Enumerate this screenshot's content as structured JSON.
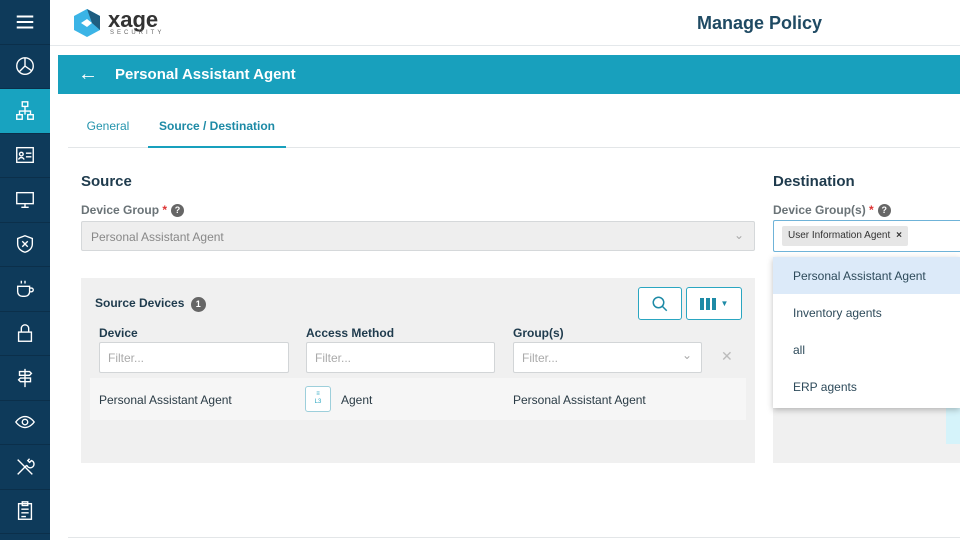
{
  "brand": {
    "name": "xage",
    "tagline": "SECURITY"
  },
  "page_title": "Manage Policy",
  "header": {
    "title": "Personal Assistant Agent"
  },
  "tabs": [
    {
      "label": "General"
    },
    {
      "label": "Source / Destination"
    }
  ],
  "source": {
    "heading": "Source",
    "device_group_label": "Device Group",
    "device_group_value": "Personal Assistant Agent",
    "devices": {
      "title": "Source Devices",
      "count": "1",
      "columns": [
        "Device",
        "Access Method",
        "Group(s)"
      ],
      "filter_placeholder": "Filter...",
      "rows": [
        {
          "device": "Personal Assistant Agent",
          "access_icon_text": "L3",
          "access_method": "Agent",
          "groups": "Personal Assistant Agent"
        }
      ]
    }
  },
  "destination": {
    "heading": "Destination",
    "device_groups_label": "Device Group(s)",
    "selected": [
      "User Information Agent"
    ],
    "options": [
      "Personal Assistant Agent",
      "Inventory agents",
      "all",
      "ERP agents"
    ]
  },
  "colors": {
    "sidebar": "#0e3a5a",
    "accent": "#18a0bd"
  }
}
